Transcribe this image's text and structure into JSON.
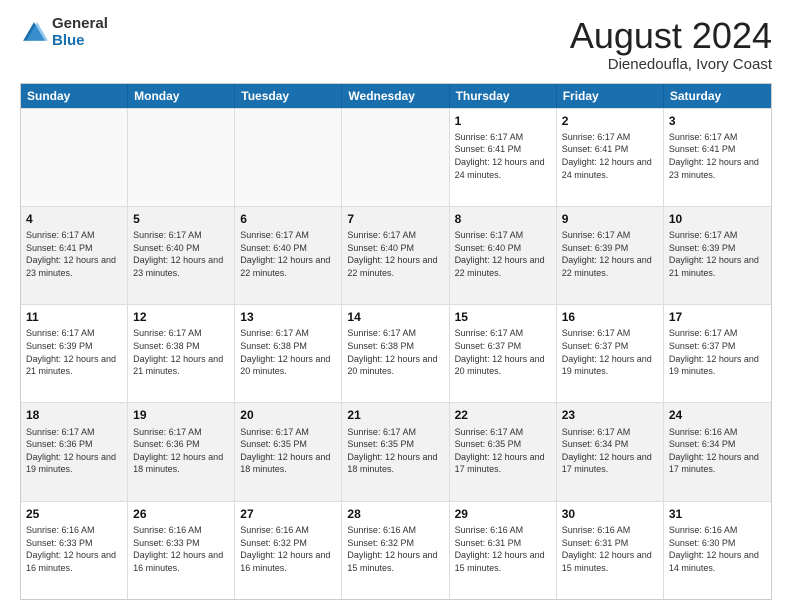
{
  "header": {
    "logo_general": "General",
    "logo_blue": "Blue",
    "month_title": "August 2024",
    "location": "Dienedoufla, Ivory Coast"
  },
  "weekdays": [
    "Sunday",
    "Monday",
    "Tuesday",
    "Wednesday",
    "Thursday",
    "Friday",
    "Saturday"
  ],
  "weeks": [
    [
      {
        "day": "",
        "sunrise": "",
        "sunset": "",
        "daylight": "",
        "empty": true
      },
      {
        "day": "",
        "sunrise": "",
        "sunset": "",
        "daylight": "",
        "empty": true
      },
      {
        "day": "",
        "sunrise": "",
        "sunset": "",
        "daylight": "",
        "empty": true
      },
      {
        "day": "",
        "sunrise": "",
        "sunset": "",
        "daylight": "",
        "empty": true
      },
      {
        "day": "1",
        "sunrise": "Sunrise: 6:17 AM",
        "sunset": "Sunset: 6:41 PM",
        "daylight": "Daylight: 12 hours and 24 minutes.",
        "empty": false
      },
      {
        "day": "2",
        "sunrise": "Sunrise: 6:17 AM",
        "sunset": "Sunset: 6:41 PM",
        "daylight": "Daylight: 12 hours and 24 minutes.",
        "empty": false
      },
      {
        "day": "3",
        "sunrise": "Sunrise: 6:17 AM",
        "sunset": "Sunset: 6:41 PM",
        "daylight": "Daylight: 12 hours and 23 minutes.",
        "empty": false
      }
    ],
    [
      {
        "day": "4",
        "sunrise": "Sunrise: 6:17 AM",
        "sunset": "Sunset: 6:41 PM",
        "daylight": "Daylight: 12 hours and 23 minutes.",
        "empty": false
      },
      {
        "day": "5",
        "sunrise": "Sunrise: 6:17 AM",
        "sunset": "Sunset: 6:40 PM",
        "daylight": "Daylight: 12 hours and 23 minutes.",
        "empty": false
      },
      {
        "day": "6",
        "sunrise": "Sunrise: 6:17 AM",
        "sunset": "Sunset: 6:40 PM",
        "daylight": "Daylight: 12 hours and 22 minutes.",
        "empty": false
      },
      {
        "day": "7",
        "sunrise": "Sunrise: 6:17 AM",
        "sunset": "Sunset: 6:40 PM",
        "daylight": "Daylight: 12 hours and 22 minutes.",
        "empty": false
      },
      {
        "day": "8",
        "sunrise": "Sunrise: 6:17 AM",
        "sunset": "Sunset: 6:40 PM",
        "daylight": "Daylight: 12 hours and 22 minutes.",
        "empty": false
      },
      {
        "day": "9",
        "sunrise": "Sunrise: 6:17 AM",
        "sunset": "Sunset: 6:39 PM",
        "daylight": "Daylight: 12 hours and 22 minutes.",
        "empty": false
      },
      {
        "day": "10",
        "sunrise": "Sunrise: 6:17 AM",
        "sunset": "Sunset: 6:39 PM",
        "daylight": "Daylight: 12 hours and 21 minutes.",
        "empty": false
      }
    ],
    [
      {
        "day": "11",
        "sunrise": "Sunrise: 6:17 AM",
        "sunset": "Sunset: 6:39 PM",
        "daylight": "Daylight: 12 hours and 21 minutes.",
        "empty": false
      },
      {
        "day": "12",
        "sunrise": "Sunrise: 6:17 AM",
        "sunset": "Sunset: 6:38 PM",
        "daylight": "Daylight: 12 hours and 21 minutes.",
        "empty": false
      },
      {
        "day": "13",
        "sunrise": "Sunrise: 6:17 AM",
        "sunset": "Sunset: 6:38 PM",
        "daylight": "Daylight: 12 hours and 20 minutes.",
        "empty": false
      },
      {
        "day": "14",
        "sunrise": "Sunrise: 6:17 AM",
        "sunset": "Sunset: 6:38 PM",
        "daylight": "Daylight: 12 hours and 20 minutes.",
        "empty": false
      },
      {
        "day": "15",
        "sunrise": "Sunrise: 6:17 AM",
        "sunset": "Sunset: 6:37 PM",
        "daylight": "Daylight: 12 hours and 20 minutes.",
        "empty": false
      },
      {
        "day": "16",
        "sunrise": "Sunrise: 6:17 AM",
        "sunset": "Sunset: 6:37 PM",
        "daylight": "Daylight: 12 hours and 19 minutes.",
        "empty": false
      },
      {
        "day": "17",
        "sunrise": "Sunrise: 6:17 AM",
        "sunset": "Sunset: 6:37 PM",
        "daylight": "Daylight: 12 hours and 19 minutes.",
        "empty": false
      }
    ],
    [
      {
        "day": "18",
        "sunrise": "Sunrise: 6:17 AM",
        "sunset": "Sunset: 6:36 PM",
        "daylight": "Daylight: 12 hours and 19 minutes.",
        "empty": false
      },
      {
        "day": "19",
        "sunrise": "Sunrise: 6:17 AM",
        "sunset": "Sunset: 6:36 PM",
        "daylight": "Daylight: 12 hours and 18 minutes.",
        "empty": false
      },
      {
        "day": "20",
        "sunrise": "Sunrise: 6:17 AM",
        "sunset": "Sunset: 6:35 PM",
        "daylight": "Daylight: 12 hours and 18 minutes.",
        "empty": false
      },
      {
        "day": "21",
        "sunrise": "Sunrise: 6:17 AM",
        "sunset": "Sunset: 6:35 PM",
        "daylight": "Daylight: 12 hours and 18 minutes.",
        "empty": false
      },
      {
        "day": "22",
        "sunrise": "Sunrise: 6:17 AM",
        "sunset": "Sunset: 6:35 PM",
        "daylight": "Daylight: 12 hours and 17 minutes.",
        "empty": false
      },
      {
        "day": "23",
        "sunrise": "Sunrise: 6:17 AM",
        "sunset": "Sunset: 6:34 PM",
        "daylight": "Daylight: 12 hours and 17 minutes.",
        "empty": false
      },
      {
        "day": "24",
        "sunrise": "Sunrise: 6:16 AM",
        "sunset": "Sunset: 6:34 PM",
        "daylight": "Daylight: 12 hours and 17 minutes.",
        "empty": false
      }
    ],
    [
      {
        "day": "25",
        "sunrise": "Sunrise: 6:16 AM",
        "sunset": "Sunset: 6:33 PM",
        "daylight": "Daylight: 12 hours and 16 minutes.",
        "empty": false
      },
      {
        "day": "26",
        "sunrise": "Sunrise: 6:16 AM",
        "sunset": "Sunset: 6:33 PM",
        "daylight": "Daylight: 12 hours and 16 minutes.",
        "empty": false
      },
      {
        "day": "27",
        "sunrise": "Sunrise: 6:16 AM",
        "sunset": "Sunset: 6:32 PM",
        "daylight": "Daylight: 12 hours and 16 minutes.",
        "empty": false
      },
      {
        "day": "28",
        "sunrise": "Sunrise: 6:16 AM",
        "sunset": "Sunset: 6:32 PM",
        "daylight": "Daylight: 12 hours and 15 minutes.",
        "empty": false
      },
      {
        "day": "29",
        "sunrise": "Sunrise: 6:16 AM",
        "sunset": "Sunset: 6:31 PM",
        "daylight": "Daylight: 12 hours and 15 minutes.",
        "empty": false
      },
      {
        "day": "30",
        "sunrise": "Sunrise: 6:16 AM",
        "sunset": "Sunset: 6:31 PM",
        "daylight": "Daylight: 12 hours and 15 minutes.",
        "empty": false
      },
      {
        "day": "31",
        "sunrise": "Sunrise: 6:16 AM",
        "sunset": "Sunset: 6:30 PM",
        "daylight": "Daylight: 12 hours and 14 minutes.",
        "empty": false
      }
    ]
  ]
}
